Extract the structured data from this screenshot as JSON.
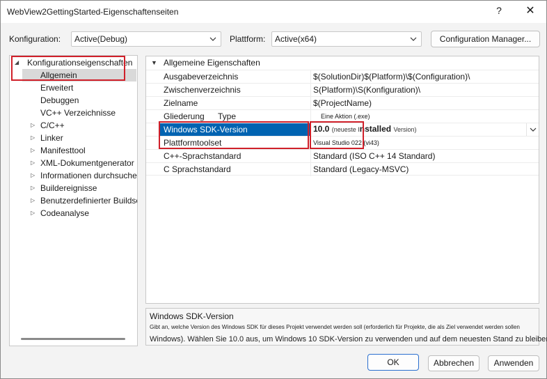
{
  "window": {
    "title": "WebView2GettingStarted-Eigenschaftenseiten",
    "help_glyph": "?",
    "close_glyph": "✕"
  },
  "toolbar": {
    "config_label": "Konfiguration:",
    "config_value": "Active(Debug)",
    "platform_label": "Plattform:",
    "platform_value": "Active(x64)",
    "config_manager": "Configuration Manager..."
  },
  "tree": {
    "root": "Konfigurationseigenschaften",
    "items": [
      {
        "label": "Allgemein"
      },
      {
        "label": "Erweitert"
      },
      {
        "label": "Debuggen"
      },
      {
        "label": "VC++ Verzeichnisse"
      },
      {
        "label": "C/C++"
      },
      {
        "label": "Linker"
      },
      {
        "label": "Manifesttool"
      },
      {
        "label": "XML-Dokumentgenerator"
      },
      {
        "label": "Informationen durchsuchen"
      },
      {
        "label": "Buildereignisse"
      },
      {
        "label": "Benutzerdefinierter Buildschritt"
      },
      {
        "label": "Codeanalyse"
      }
    ]
  },
  "grid": {
    "category": "Allgemeine Eigenschaften",
    "rows": [
      {
        "name": "Ausgabeverzeichnis",
        "value": "$(SolutionDir)$(Platform)\\$(Configuration)\\"
      },
      {
        "name": "Zwischenverzeichnis",
        "value": "S(Platform)\\S(Konfiguration)\\"
      },
      {
        "name": "Zielname",
        "value": "$(ProjectName)"
      },
      {
        "name": "Gliederung",
        "name2": "Type",
        "value": "Eine Aktion (.exe)"
      },
      {
        "name": "Windows SDK-Version",
        "value_big": "10.0",
        "value_small": "(neueste I",
        "value_big2": "nstalled",
        "value_small2": "Version)"
      },
      {
        "name": "Plattformtoolset",
        "value": "Visual Studio 022 (vi43)"
      },
      {
        "name": "C++-Sprachstandard",
        "value": "Standard (ISO C++ 14 Standard)"
      },
      {
        "name": "C Sprachstandard",
        "value": "Standard (Legacy-MSVC)"
      }
    ]
  },
  "description": {
    "title": "Windows SDK-Version",
    "line1": "Gibt an, welche Version des Windows SDK für dieses Projekt verwendet werden soll (erforderlich für Projekte, die als Ziel verwendet werden sollen",
    "line2": "Windows). Wählen Sie 10.0 aus, um Windows 10 SDK-Version zu verwenden und auf dem neuesten Stand zu bleiben."
  },
  "buttons": {
    "ok": "OK",
    "cancel": "Abbrechen",
    "apply": "Anwenden"
  },
  "colors": {
    "selection": "#0063b1",
    "highlight_box": "#d0202a",
    "primary_border": "#2a6fcf"
  }
}
